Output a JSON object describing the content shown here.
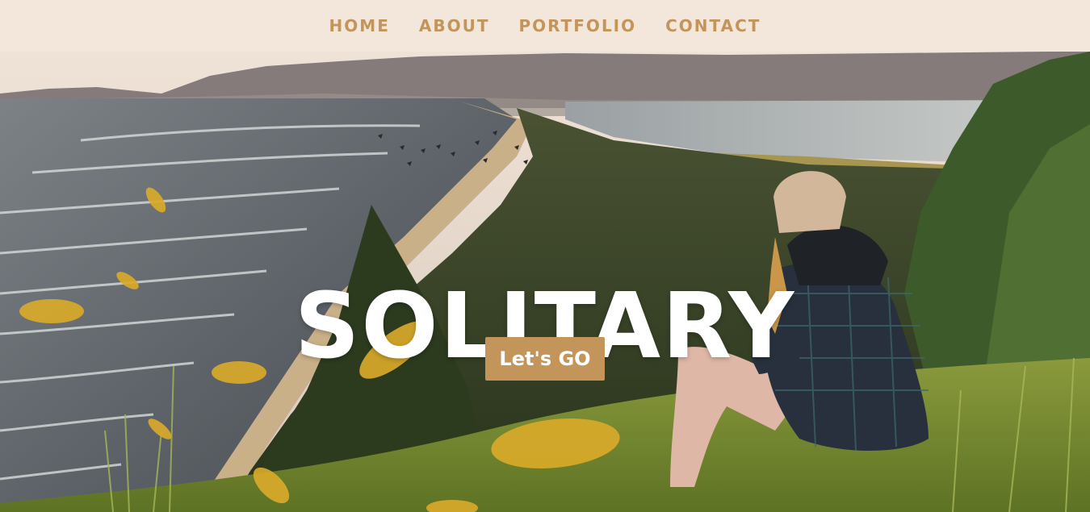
{
  "nav": {
    "items": [
      {
        "label": "HOME"
      },
      {
        "label": "ABOUT"
      },
      {
        "label": "PORTFOLIO"
      },
      {
        "label": "CONTACT"
      }
    ]
  },
  "hero": {
    "title": "SOLITARY",
    "button_label": "Let's GO"
  },
  "colors": {
    "nav_background": "#f3e6da",
    "accent": "#c3955a",
    "leaf": "#d9ab2a"
  }
}
